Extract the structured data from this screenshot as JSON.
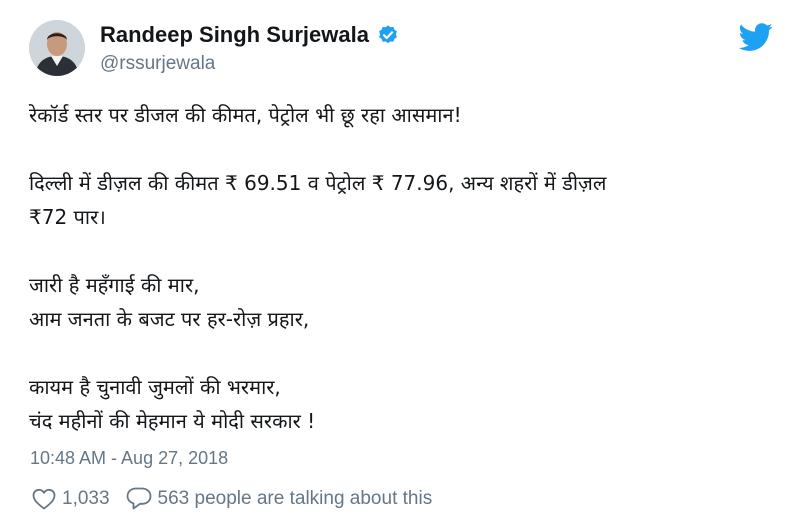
{
  "author": {
    "display_name": "Randeep Singh Surjewala",
    "handle": "@rssurjewala",
    "verified": true
  },
  "tweet": {
    "paragraphs": [
      "रेकॉर्ड स्तर पर डीजल की कीमत, पेट्रोल भी छू रहा आसमान!",
      "दिल्ली में डीज़ल की कीमत ₹ 69.51 व पेट्रोल ₹ 77.96, अन्य शहरों में डीज़ल\n₹72 पार।",
      "जारी है महँगाई की मार,\nआम जनता के बजट पर हर-रोज़ प्रहार,",
      "कायम है चुनावी जुमलों की भरमार,\nचंद महीनों की मेहमान ये मोदी सरकार !"
    ],
    "timestamp": "10:48 AM - Aug 27, 2018"
  },
  "engagement": {
    "likes": "1,033",
    "talking": "563 people are talking about this"
  },
  "icons": {
    "brand": "twitter-bird-icon",
    "verified": "verified-badge-icon",
    "like": "heart-icon",
    "reply": "speech-bubble-icon"
  },
  "colors": {
    "twitter_blue": "#1da1f2",
    "text": "#14171a",
    "secondary_text": "#657786"
  }
}
